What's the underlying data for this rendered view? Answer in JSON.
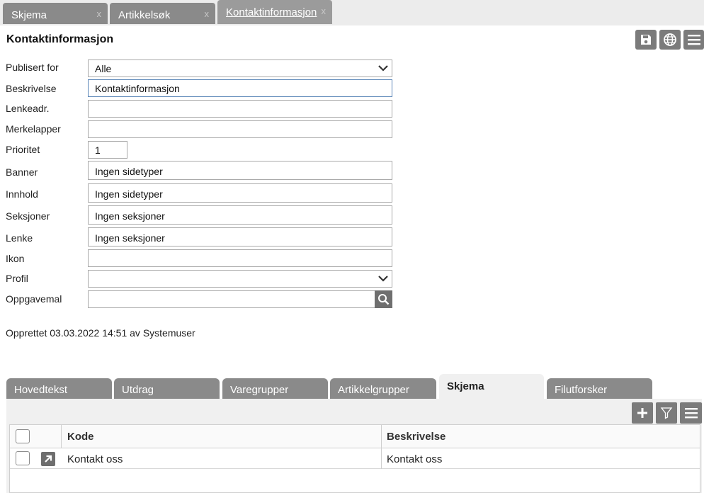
{
  "top_tabs": [
    {
      "label": "Skjema",
      "close": "x"
    },
    {
      "label": "Artikkelsøk",
      "close": "x"
    },
    {
      "label": "Kontaktinformasjon",
      "close": "x"
    }
  ],
  "header": {
    "title": "Kontaktinformasjon",
    "icons": [
      "save-icon",
      "globe-icon",
      "menu-icon"
    ]
  },
  "form": {
    "publisert_for": {
      "label": "Publisert for",
      "value": "Alle"
    },
    "beskrivelse": {
      "label": "Beskrivelse",
      "value": "Kontaktinformasjon"
    },
    "lenkeadr": {
      "label": "Lenkeadr.",
      "value": ""
    },
    "merkelapper": {
      "label": "Merkelapper",
      "value": ""
    },
    "prioritet": {
      "label": "Prioritet",
      "value": "1"
    },
    "banner": {
      "label": "Banner",
      "value": "Ingen sidetyper"
    },
    "innhold": {
      "label": "Innhold",
      "value": "Ingen sidetyper"
    },
    "seksjoner": {
      "label": "Seksjoner",
      "value": "Ingen seksjoner"
    },
    "lenke": {
      "label": "Lenke",
      "value": "Ingen seksjoner"
    },
    "ikon": {
      "label": "Ikon",
      "value": ""
    },
    "profil": {
      "label": "Profil",
      "value": ""
    },
    "oppgavemal": {
      "label": "Oppgavemal",
      "value": ""
    }
  },
  "created_text": "Opprettet 03.03.2022 14:51 av Systemuser",
  "bottom_tabs": [
    "Hovedtekst",
    "Utdrag",
    "Varegrupper",
    "Artikkelgrupper",
    "Skjema",
    "Filutforsker"
  ],
  "active_bottom_tab": "Skjema",
  "toolbar_icons": [
    "plus-icon",
    "filter-icon",
    "menu-icon"
  ],
  "grid": {
    "columns": [
      "Kode",
      "Beskrivelse"
    ],
    "rows": [
      {
        "kode": "Kontakt oss",
        "beskrivelse": "Kontakt oss"
      }
    ]
  },
  "colors": {
    "tab_bg": "#8a8a8a",
    "button_bg": "#7b7b7b",
    "panel_bg": "#f0f0f0",
    "focus_border": "#5b86b8"
  }
}
